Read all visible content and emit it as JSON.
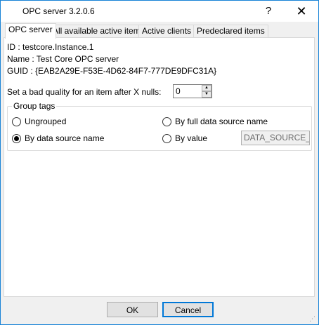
{
  "window": {
    "title": "OPC server 3.2.0.6",
    "help_glyph": "?",
    "close_glyph": "✕"
  },
  "tabs": [
    {
      "label": "OPC server",
      "active": true
    },
    {
      "label": "All available active items",
      "active": false
    },
    {
      "label": "Active clients",
      "active": false
    },
    {
      "label": "Predeclared items",
      "active": false
    }
  ],
  "info": {
    "id": "ID : testcore.Instance.1",
    "name": "Name : Test Core OPC server",
    "guid": "GUID : {EAB2A29E-F53E-4D62-84F7-777DE9DFC31A}"
  },
  "bad_quality": {
    "label": "Set a bad quality for an item after X nulls:",
    "value": "0"
  },
  "group_tags": {
    "label": "Group tags",
    "options": {
      "ungrouped": {
        "label": "Ungrouped",
        "checked": false
      },
      "by_full_name": {
        "label": "By full data source name",
        "checked": false
      },
      "by_name": {
        "label": "By data source name",
        "checked": true
      },
      "by_value": {
        "label": "By value",
        "checked": false
      }
    },
    "value_input": "DATA_SOURCE_ID"
  },
  "buttons": {
    "ok": "OK",
    "cancel": "Cancel"
  }
}
